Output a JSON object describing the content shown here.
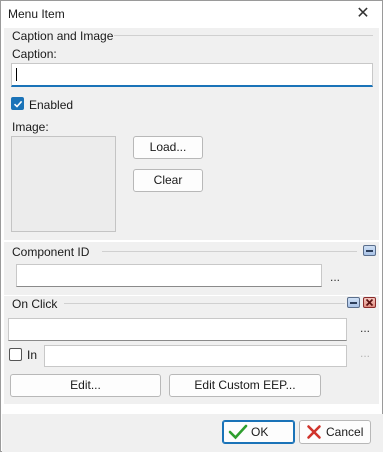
{
  "window": {
    "title": "Menu Item",
    "close_glyph": "✕"
  },
  "caption_image": {
    "section_title": "Caption and Image",
    "caption_label": "Caption:",
    "caption_value": "",
    "enabled_label": "Enabled",
    "enabled_checked": true,
    "image_label": "Image:",
    "load_label": "Load...",
    "clear_label": "Clear"
  },
  "component_id": {
    "section_title": "Component ID",
    "value": "",
    "ellipsis": "..."
  },
  "on_click": {
    "section_title": "On Click",
    "value": "",
    "ellipsis": "...",
    "in_label": "In",
    "in_checked": false,
    "in_value": "",
    "in_ellipsis": "...",
    "edit_label": "Edit...",
    "edit_custom_label": "Edit Custom EEP..."
  },
  "footer": {
    "ok_label": "OK",
    "cancel_label": "Cancel"
  },
  "colors": {
    "accent": "#1a73b8",
    "ok_check": "#2e9e2e",
    "cancel_x": "#d0342c"
  }
}
